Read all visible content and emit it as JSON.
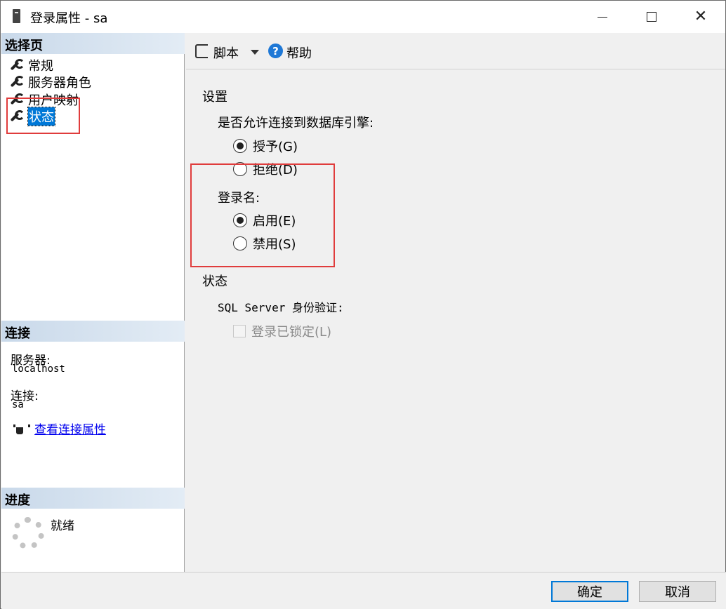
{
  "window": {
    "title": "登录属性 - sa",
    "min_icon": "minimize-icon",
    "max_icon": "maximize-icon",
    "close_icon": "close-icon",
    "close_glyph": "✕"
  },
  "left": {
    "select_page_header": "选择页",
    "pages": [
      {
        "label": "常规",
        "icon": "wrench-icon"
      },
      {
        "label": "服务器角色",
        "icon": "wrench-icon"
      },
      {
        "label": "用户映射",
        "icon": "wrench-icon"
      },
      {
        "label": "状态",
        "icon": "wrench-icon",
        "selected": true
      }
    ],
    "connection_header": "连接",
    "server_label": "服务器:",
    "server_value": "localhost",
    "connection_label": "连接:",
    "connection_value": "sa",
    "view_connection_link": "查看连接属性",
    "progress_header": "进度",
    "progress_status": "就绪"
  },
  "toolbar": {
    "script_label": "脚本",
    "help_label": "帮助",
    "help_glyph": "?"
  },
  "settings": {
    "section_title": "设置",
    "db_engine_question": "是否允许连接到数据库引擎:",
    "grant_label": "授予(G)",
    "deny_label": "拒绝(D)",
    "login_label": "登录名:",
    "enabled_label": "启用(E)",
    "disabled_label": "禁用(S)",
    "status_title": "状态",
    "sql_auth_label": "SQL Server 身份验证:",
    "locked_label": "登录已锁定(L)",
    "grant_checked": true,
    "enabled_checked": true,
    "locked_checked": false
  },
  "buttons": {
    "ok": "确定",
    "cancel": "取消"
  },
  "colors": {
    "highlight": "#e03c3c",
    "selection": "#0078d7",
    "link": "#0000ee"
  }
}
